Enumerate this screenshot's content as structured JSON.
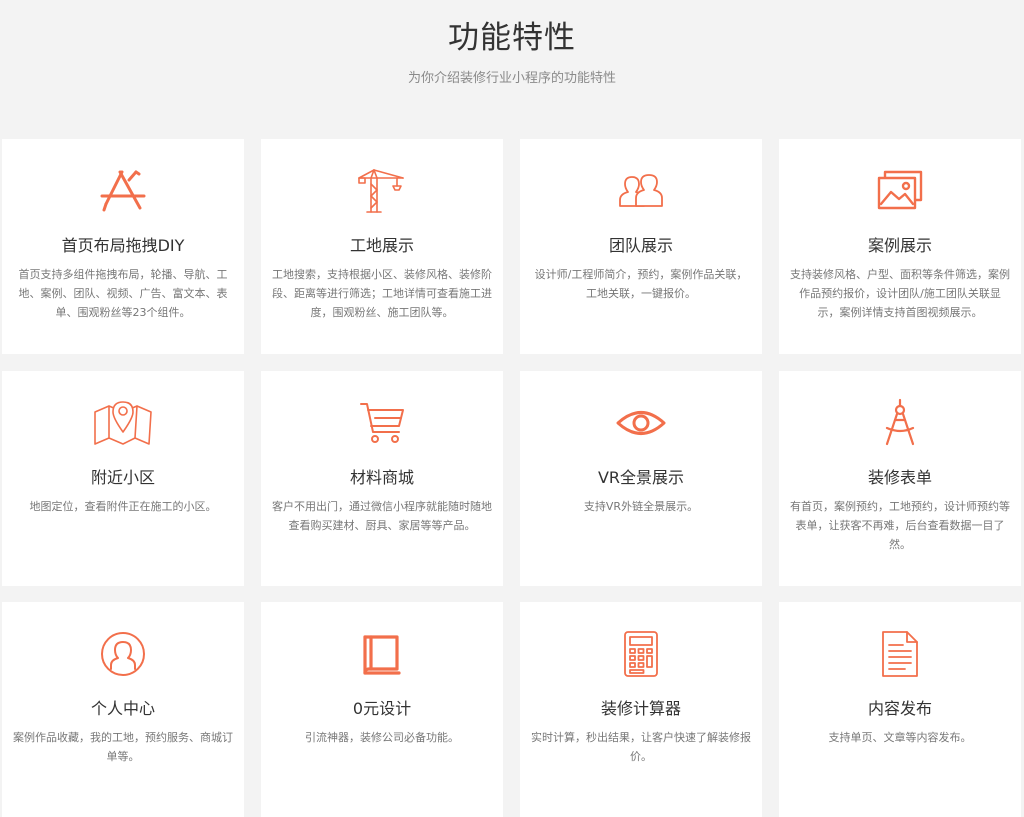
{
  "header": {
    "title": "功能特性",
    "subtitle": "为你介绍装修行业小程序的功能特性"
  },
  "theme": {
    "accent": "#f26f4b",
    "card_bg": "#ffffff",
    "page_bg": "#f3f3f3"
  },
  "features": [
    {
      "icon": "app-store-icon",
      "title": "首页布局拖拽DIY",
      "desc": "首页支持多组件拖拽布局，轮播、导航、工地、案例、团队、视频、广告、富文本、表单、围观粉丝等23个组件。"
    },
    {
      "icon": "crane-icon",
      "title": "工地展示",
      "desc": "工地搜索，支持根据小区、装修风格、装修阶段、距离等进行筛选；工地详情可查看施工进度，围观粉丝、施工团队等。"
    },
    {
      "icon": "team-icon",
      "title": "团队展示",
      "desc": "设计师/工程师简介，预约，案例作品关联，工地关联，一键报价。"
    },
    {
      "icon": "gallery-icon",
      "title": "案例展示",
      "desc": "支持装修风格、户型、面积等条件筛选，案例作品预约报价，设计团队/施工团队关联显示，案例详情支持首图视频展示。"
    },
    {
      "icon": "map-location-icon",
      "title": "附近小区",
      "desc": "地图定位，查看附件正在施工的小区。"
    },
    {
      "icon": "shopping-cart-icon",
      "title": "材料商城",
      "desc": "客户不用出门，通过微信小程序就能随时随地查看购买建材、厨具、家居等等产品。"
    },
    {
      "icon": "eye-icon",
      "title": "VR全景展示",
      "desc": "支持VR外链全景展示。"
    },
    {
      "icon": "compass-icon",
      "title": "装修表单",
      "desc": "有首页，案例预约，工地预约，设计师预约等表单，让获客不再难，后台查看数据一目了然。"
    },
    {
      "icon": "user-circle-icon",
      "title": "个人中心",
      "desc": "案例作品收藏，我的工地，预约服务、商城订单等。"
    },
    {
      "icon": "book-icon",
      "title": "0元设计",
      "desc": "引流神器，装修公司必备功能。"
    },
    {
      "icon": "calculator-icon",
      "title": "装修计算器",
      "desc": "实时计算，秒出结果，让客户快速了解装修报价。"
    },
    {
      "icon": "document-icon",
      "title": "内容发布",
      "desc": "支持单页、文章等内容发布。"
    }
  ]
}
